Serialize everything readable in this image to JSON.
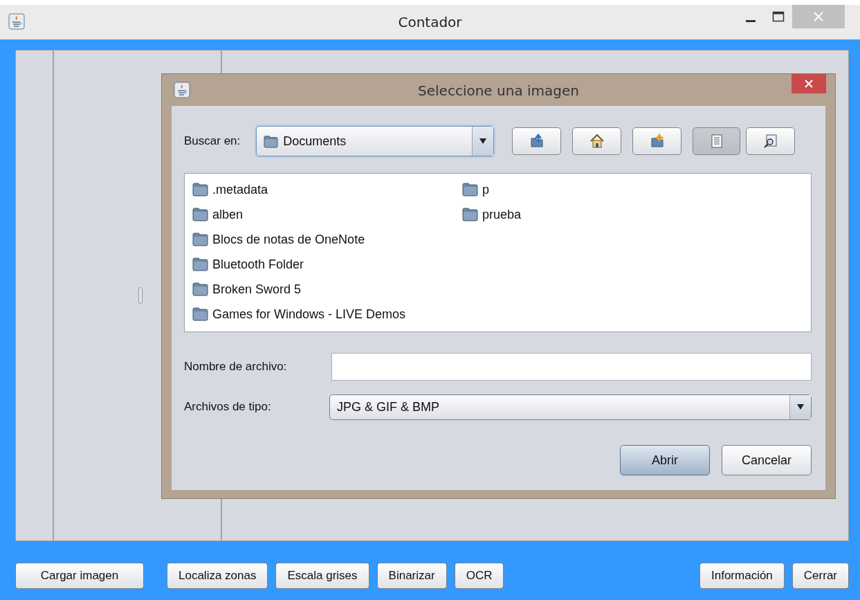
{
  "window": {
    "title": "Contador"
  },
  "dialog": {
    "title": "Seleccione una imagen",
    "look_in": {
      "label": "Buscar en:",
      "value": "Documents"
    },
    "toolbar": [
      {
        "kind": "up",
        "selected": false
      },
      {
        "kind": "home",
        "selected": false
      },
      {
        "kind": "new-folder",
        "selected": false
      },
      {
        "kind": "list",
        "selected": true
      },
      {
        "kind": "details",
        "selected": false
      }
    ],
    "files": [
      {
        "name": ".metadata"
      },
      {
        "name": "alben"
      },
      {
        "name": "Blocs de notas de OneNote"
      },
      {
        "name": "Bluetooth Folder"
      },
      {
        "name": "Broken Sword 5"
      },
      {
        "name": "Games for Windows - LIVE Demos"
      },
      {
        "name": "p"
      },
      {
        "name": "prueba"
      }
    ],
    "file_name": {
      "label": "Nombre de archivo:"
    },
    "file_type": {
      "label": "Archivos de tipo:",
      "value": "JPG & GIF & BMP"
    },
    "buttons": [
      {
        "label": "Abrir",
        "default": true
      },
      {
        "label": "Cancelar",
        "default": false
      }
    ]
  },
  "bottom_buttons": [
    {
      "label": "Cargar imagen",
      "kind": "left"
    },
    {
      "label": "Localiza zonas",
      "kind": "middle"
    },
    {
      "label": "Escala grises",
      "kind": "middle"
    },
    {
      "label": "Binarizar",
      "kind": "middle"
    },
    {
      "label": "OCR",
      "kind": "middle"
    },
    {
      "label": "Información",
      "kind": "right"
    },
    {
      "label": "Cerrar",
      "kind": "right"
    }
  ]
}
